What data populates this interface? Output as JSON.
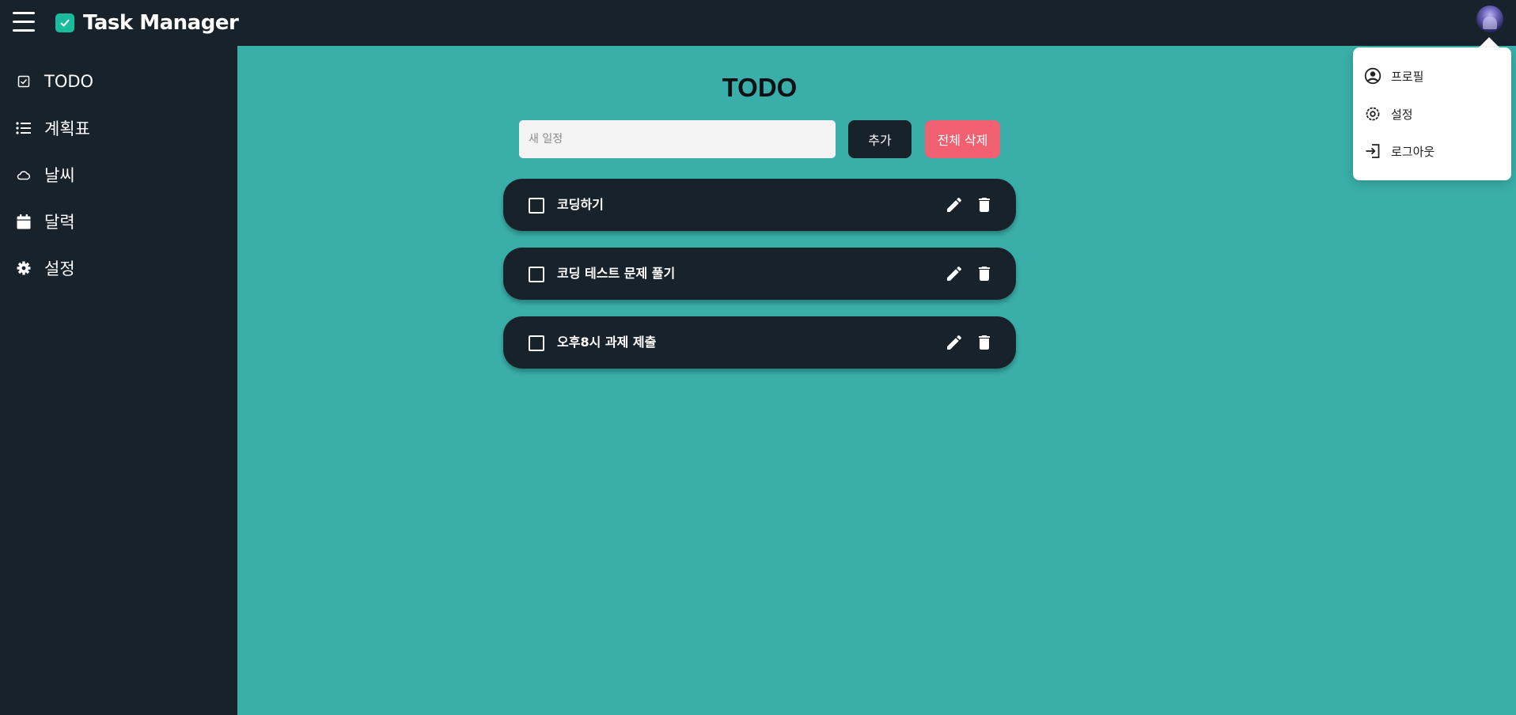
{
  "header": {
    "title": "Task Manager"
  },
  "sidebar": {
    "items": [
      {
        "label": "TODO",
        "icon": "checkbox-icon"
      },
      {
        "label": "계획표",
        "icon": "list-icon"
      },
      {
        "label": "날씨",
        "icon": "cloud-icon"
      },
      {
        "label": "달력",
        "icon": "calendar-icon"
      },
      {
        "label": "설정",
        "icon": "gear-icon"
      }
    ]
  },
  "main": {
    "title": "TODO",
    "input_placeholder": "새 일정",
    "add_label": "추가",
    "delete_all_label": "전체 삭제",
    "todos": [
      {
        "text": "코딩하기",
        "done": false
      },
      {
        "text": "코딩 테스트 문제 풀기",
        "done": false
      },
      {
        "text": "오후8시 과제 제출",
        "done": false
      }
    ]
  },
  "user_menu": {
    "items": [
      {
        "label": "프로필",
        "icon": "user-circle-icon"
      },
      {
        "label": "설정",
        "icon": "settings-icon"
      },
      {
        "label": "로그아웃",
        "icon": "logout-icon"
      }
    ]
  },
  "colors": {
    "background": "#3aafa9",
    "panel": "#18222a",
    "brand_accent": "#1bbc9b",
    "danger": "#f06071"
  }
}
